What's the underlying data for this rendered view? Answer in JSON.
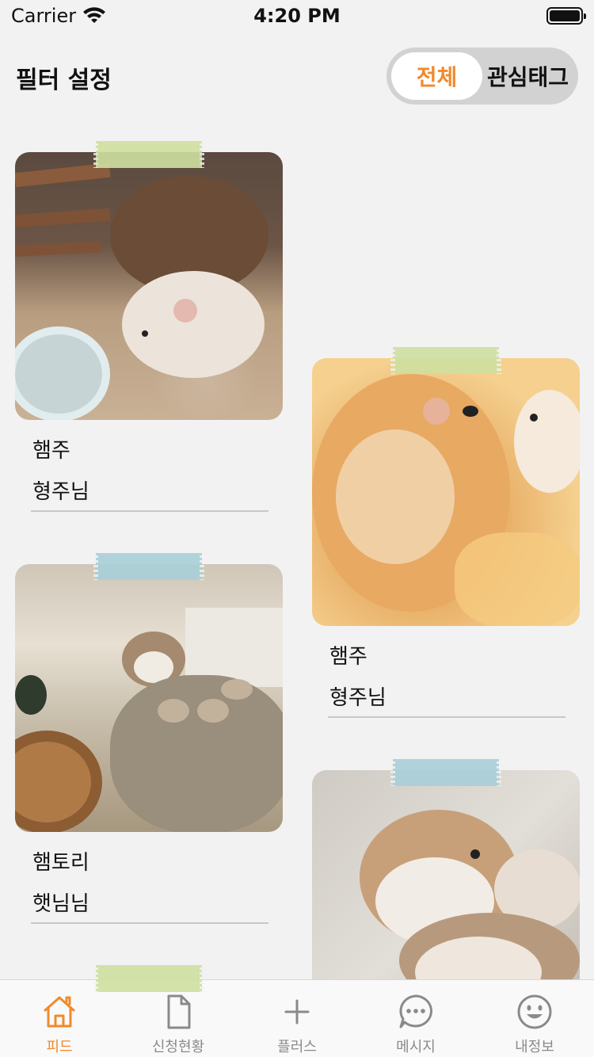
{
  "status_bar": {
    "carrier": "Carrier",
    "time": "4:20 PM"
  },
  "header": {
    "title": "필터 설정",
    "segments": [
      {
        "label": "전체",
        "active": true
      },
      {
        "label": "관심태그",
        "active": false
      }
    ]
  },
  "feed": {
    "cards": [
      {
        "name": "햄주",
        "owner": "형주님",
        "tape_color": "#cfe0a0"
      },
      {
        "name": "햄주",
        "owner": "형주님",
        "tape_color": "#cfe0a0"
      },
      {
        "name": "햄토리",
        "owner": "햇님님",
        "tape_color": "#a9cfd9"
      },
      {
        "name": "",
        "owner": "",
        "tape_color": "#a9cfd9"
      },
      {
        "name": "",
        "owner": "",
        "tape_color": "#cfe0a0"
      }
    ]
  },
  "tab_bar": {
    "accent": "#f08a2c",
    "items": [
      {
        "label": "피드",
        "icon": "home-icon",
        "active": true
      },
      {
        "label": "신청현황",
        "icon": "document-icon",
        "active": false
      },
      {
        "label": "플러스",
        "icon": "plus-icon",
        "active": false
      },
      {
        "label": "메시지",
        "icon": "chat-icon",
        "active": false
      },
      {
        "label": "내정보",
        "icon": "smile-icon",
        "active": false
      }
    ]
  }
}
